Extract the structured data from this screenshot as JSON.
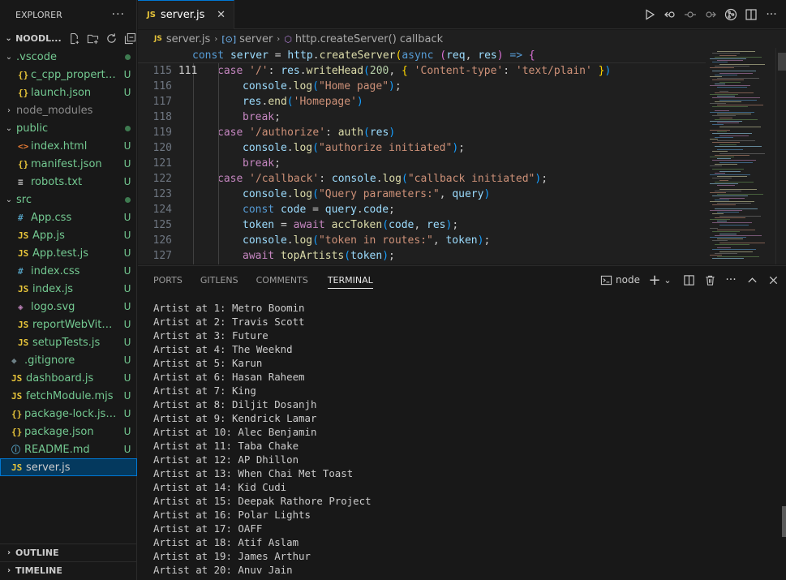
{
  "explorer": {
    "title": "EXPLORER",
    "more": "···",
    "folder": "NOODL...",
    "items": [
      {
        "type": "folder",
        "open": true,
        "label": ".vscode",
        "status": "dot",
        "indent": 1,
        "color": "#73c991"
      },
      {
        "type": "file",
        "icon": "{}",
        "iconColor": "#e8c53a",
        "label": "c_cpp_properti...",
        "status": "U",
        "indent": 2
      },
      {
        "type": "file",
        "icon": "{}",
        "iconColor": "#e8c53a",
        "label": "launch.json",
        "status": "U",
        "indent": 2
      },
      {
        "type": "folder",
        "open": false,
        "label": "node_modules",
        "status": "",
        "indent": 1,
        "grey": true
      },
      {
        "type": "folder",
        "open": true,
        "label": "public",
        "status": "dot",
        "indent": 1
      },
      {
        "type": "file",
        "icon": "<>",
        "iconColor": "#e37933",
        "label": "index.html",
        "status": "U",
        "indent": 2
      },
      {
        "type": "file",
        "icon": "{}",
        "iconColor": "#e8c53a",
        "label": "manifest.json",
        "status": "U",
        "indent": 2
      },
      {
        "type": "file",
        "icon": "≡",
        "iconColor": "#cccccc",
        "label": "robots.txt",
        "status": "U",
        "indent": 2
      },
      {
        "type": "folder",
        "open": true,
        "label": "src",
        "status": "dot",
        "indent": 1
      },
      {
        "type": "file",
        "icon": "#",
        "iconColor": "#519aba",
        "label": "App.css",
        "status": "U",
        "indent": 2
      },
      {
        "type": "file",
        "icon": "JS",
        "iconColor": "#e8c53a",
        "label": "App.js",
        "status": "U",
        "indent": 2
      },
      {
        "type": "file",
        "icon": "JS",
        "iconColor": "#e8c53a",
        "label": "App.test.js",
        "status": "U",
        "indent": 2
      },
      {
        "type": "file",
        "icon": "#",
        "iconColor": "#519aba",
        "label": "index.css",
        "status": "U",
        "indent": 2
      },
      {
        "type": "file",
        "icon": "JS",
        "iconColor": "#e8c53a",
        "label": "index.js",
        "status": "U",
        "indent": 2
      },
      {
        "type": "file",
        "icon": "◈",
        "iconColor": "#c586c0",
        "label": "logo.svg",
        "status": "U",
        "indent": 2
      },
      {
        "type": "file",
        "icon": "JS",
        "iconColor": "#e8c53a",
        "label": "reportWebVital...",
        "status": "U",
        "indent": 2
      },
      {
        "type": "file",
        "icon": "JS",
        "iconColor": "#e8c53a",
        "label": "setupTests.js",
        "status": "U",
        "indent": 2
      },
      {
        "type": "file",
        "icon": "◆",
        "iconColor": "#6d8086",
        "label": ".gitignore",
        "status": "U",
        "indent": 1
      },
      {
        "type": "file",
        "icon": "JS",
        "iconColor": "#e8c53a",
        "label": "dashboard.js",
        "status": "U",
        "indent": 1
      },
      {
        "type": "file",
        "icon": "JS",
        "iconColor": "#e8c53a",
        "label": "fetchModule.mjs",
        "status": "U",
        "indent": 1
      },
      {
        "type": "file",
        "icon": "{}",
        "iconColor": "#e8c53a",
        "label": "package-lock.json",
        "status": "U",
        "indent": 1
      },
      {
        "type": "file",
        "icon": "{}",
        "iconColor": "#e8c53a",
        "label": "package.json",
        "status": "U",
        "indent": 1
      },
      {
        "type": "file",
        "icon": "ⓘ",
        "iconColor": "#519aba",
        "label": "README.md",
        "status": "U",
        "indent": 1
      },
      {
        "type": "file",
        "icon": "JS",
        "iconColor": "#e8c53a",
        "label": "server.js",
        "status": "",
        "indent": 1,
        "selected": true
      }
    ],
    "outline": "OUTLINE",
    "timeline": "TIMELINE"
  },
  "tab": {
    "badge": "JS",
    "name": "server.js",
    "close": "✕"
  },
  "breadcrumb": {
    "file": "server.js",
    "symbol1": "server",
    "symbol2": "http.createServer() callback",
    "badge": "JS"
  },
  "code": {
    "sticky": {
      "num": "111",
      "text": "const server = http.createServer(async (req, res) => {"
    },
    "lines": [
      {
        "num": "115",
        "indent": 2,
        "html": "<span class='kc'>case</span> <span class='s'>'/'</span><span class='p'>: </span><span class='v'>res</span><span class='p'>.</span><span class='f'>writeHead</span><span class='b3'>(</span><span class='n'>200</span><span class='p'>, </span><span class='b1'>{</span> <span class='s'>'Content-type'</span><span class='p'>: </span><span class='s'>'text/plain'</span> <span class='b1'>}</span><span class='b3'>)</span>"
      },
      {
        "num": "116",
        "indent": 3,
        "html": "<span class='v'>console</span><span class='p'>.</span><span class='f'>log</span><span class='b3'>(</span><span class='s'>\"Home page\"</span><span class='b3'>)</span><span class='p'>;</span>"
      },
      {
        "num": "117",
        "indent": 3,
        "html": "<span class='v'>res</span><span class='p'>.</span><span class='f'>end</span><span class='b3'>(</span><span class='s'>'Homepage'</span><span class='b3'>)</span>"
      },
      {
        "num": "118",
        "indent": 3,
        "html": "<span class='kc'>break</span><span class='p'>;</span>"
      },
      {
        "num": "119",
        "indent": 2,
        "html": "<span class='kc'>case</span> <span class='s'>'/authorize'</span><span class='p'>: </span><span class='f'>auth</span><span class='b3'>(</span><span class='v'>res</span><span class='b3'>)</span>"
      },
      {
        "num": "120",
        "indent": 3,
        "html": "<span class='v'>console</span><span class='p'>.</span><span class='f'>log</span><span class='b3'>(</span><span class='s'>\"authorize initiated\"</span><span class='b3'>)</span><span class='p'>;</span>"
      },
      {
        "num": "121",
        "indent": 3,
        "html": "<span class='kc'>break</span><span class='p'>;</span>"
      },
      {
        "num": "122",
        "indent": 2,
        "html": "<span class='kc'>case</span> <span class='s'>'/callback'</span><span class='p'>: </span><span class='v'>console</span><span class='p'>.</span><span class='f'>log</span><span class='b3'>(</span><span class='s'>\"callback initiated\"</span><span class='b3'>)</span><span class='p'>;</span>"
      },
      {
        "num": "123",
        "indent": 3,
        "html": "<span class='v'>console</span><span class='p'>.</span><span class='f'>log</span><span class='b3'>(</span><span class='s'>\"Query parameters:\"</span><span class='p'>, </span><span class='v'>query</span><span class='b3'>)</span>"
      },
      {
        "num": "124",
        "indent": 3,
        "html": "<span class='k'>const</span> <span class='v'>code</span> <span class='p'>= </span><span class='v'>query</span><span class='p'>.</span><span class='v'>code</span><span class='p'>;</span>"
      },
      {
        "num": "125",
        "indent": 3,
        "html": "<span class='v'>token</span> <span class='p'>= </span><span class='kc'>await</span> <span class='f'>accToken</span><span class='b3'>(</span><span class='v'>code</span><span class='p'>, </span><span class='v'>res</span><span class='b3'>)</span><span class='p'>;</span>"
      },
      {
        "num": "126",
        "indent": 3,
        "html": "<span class='v'>console</span><span class='p'>.</span><span class='f'>log</span><span class='b3'>(</span><span class='s'>\"token in routes:\"</span><span class='p'>, </span><span class='v'>token</span><span class='b3'>)</span><span class='p'>;</span>"
      },
      {
        "num": "127",
        "indent": 3,
        "html": "<span class='kc'>await</span> <span class='f'>topArtists</span><span class='b3'>(</span><span class='v'>token</span><span class='b3'>)</span><span class='p'>;</span>"
      }
    ]
  },
  "panel": {
    "tabs": [
      "PORTS",
      "GITLENS",
      "COMMENTS",
      "TERMINAL"
    ],
    "active": "TERMINAL",
    "shell": "node",
    "terminal": [
      "Artist at 1: Metro Boomin",
      "Artist at 2: Travis Scott",
      "Artist at 3: Future",
      "Artist at 4: The Weeknd",
      "Artist at 5: Karun",
      "Artist at 6: Hasan Raheem",
      "Artist at 7: King",
      "Artist at 8: Diljit Dosanjh",
      "Artist at 9: Kendrick Lamar",
      "Artist at 10: Alec Benjamin",
      "Artist at 11: Taba Chake",
      "Artist at 12: AP Dhillon",
      "Artist at 13: When Chai Met Toast",
      "Artist at 14: Kid Cudi",
      "Artist at 15: Deepak Rathore Project",
      "Artist at 16: Polar Lights",
      "Artist at 17: OAFF",
      "Artist at 18: Atif Aslam",
      "Artist at 19: James Arthur",
      "Artist at 20: Anuv Jain"
    ]
  },
  "colors": {
    "accent": "#0078d4",
    "untracked": "#73c991",
    "jsYellow": "#e8c53a"
  }
}
